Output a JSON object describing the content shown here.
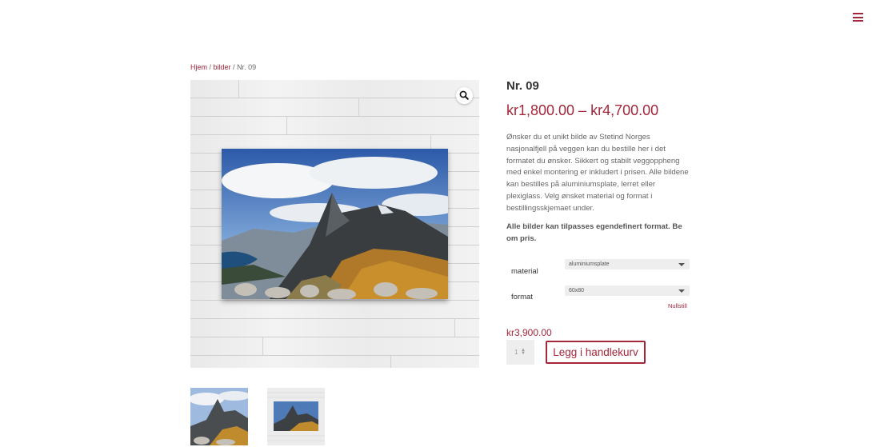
{
  "header": {
    "menu_icon": "hamburger-menu-icon"
  },
  "breadcrumb": {
    "home": "Hjem",
    "separator": " / ",
    "category": "bilder",
    "current": "Nr. 09"
  },
  "product": {
    "title": "Nr. 09",
    "price_range": "kr1,800.00 – kr4,700.00",
    "description": "Ønsker du et unikt bilde av Stetind Norges nasjonalfjell på veggen kan du bestille her i det formatet du ønsker. Sikkert og stabilt veggoppheng med enkel montering er inkludert i prisen. Alle bildene kan bestilles på aluminiumsplate, lerret eller plexiglass. Velg ønsket material og format i bestillingsskjemaet under.",
    "note": "Alle bilder kan tilpasses egendefinert format. Be om pris."
  },
  "options": {
    "material_label": "material",
    "material_value": "aluminiumsplate",
    "format_label": "format",
    "format_value": "60x80",
    "reset_label": "Nullstill"
  },
  "purchase": {
    "unit_price": "kr3,900.00",
    "quantity": "1",
    "add_to_cart_label": "Legg i handlekurv"
  },
  "colors": {
    "accent": "#a3273b",
    "text": "#666666",
    "heading": "#333333",
    "field_bg": "#eeeeee"
  },
  "icons": {
    "zoom": "magnifier-icon",
    "select_arrow": "chevron-down-icon",
    "qty_spin": "spinner-arrows-icon"
  }
}
